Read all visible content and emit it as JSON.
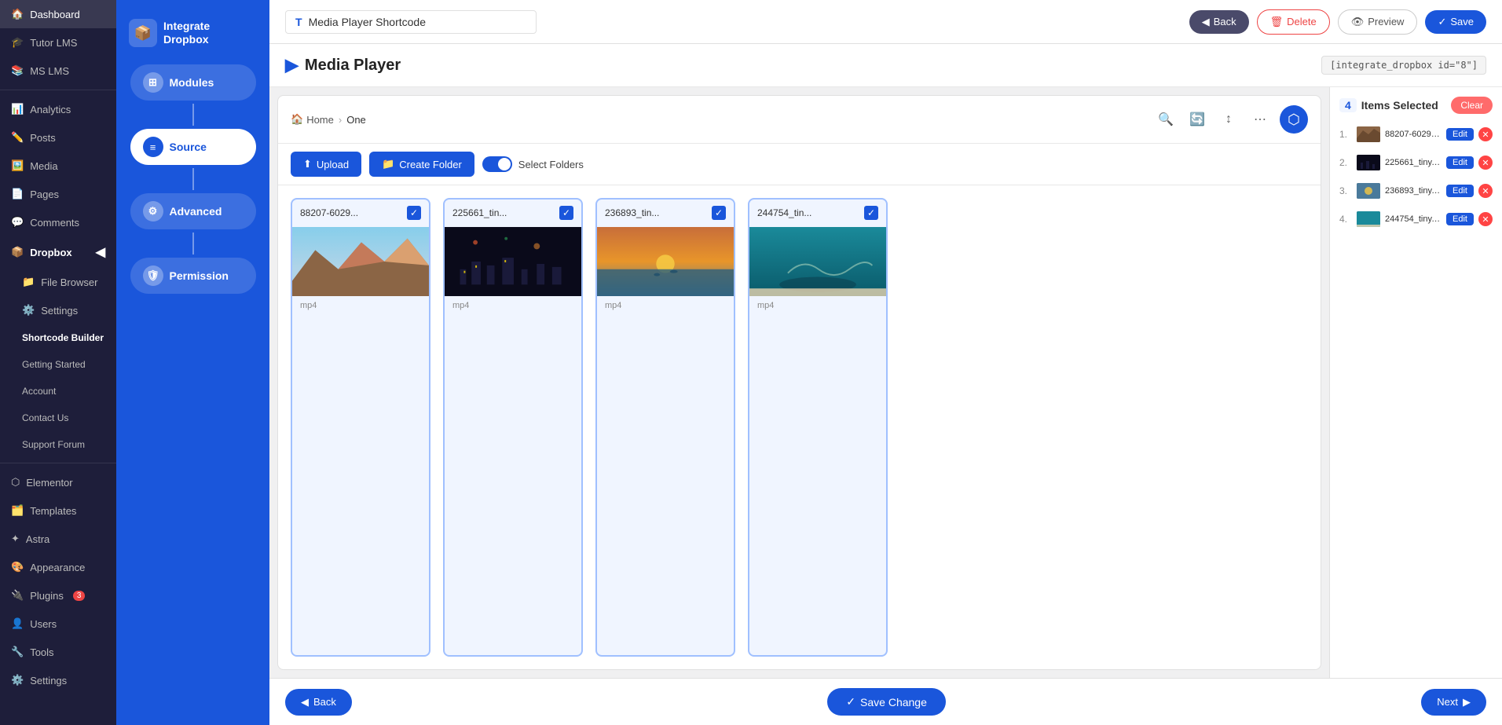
{
  "sidebar": {
    "items": [
      {
        "label": "Dashboard",
        "icon": "🏠"
      },
      {
        "label": "Tutor LMS",
        "icon": "🎓"
      },
      {
        "label": "MS LMS",
        "icon": "📚"
      },
      {
        "label": "Analytics",
        "icon": "📊"
      },
      {
        "label": "Posts",
        "icon": "✏️"
      },
      {
        "label": "Media",
        "icon": "🖼️"
      },
      {
        "label": "Pages",
        "icon": "📄"
      },
      {
        "label": "Comments",
        "icon": "💬"
      },
      {
        "label": "Dropbox",
        "icon": "📦"
      },
      {
        "label": "File Browser",
        "icon": "📁"
      },
      {
        "label": "Settings",
        "icon": "⚙️"
      },
      {
        "label": "Shortcode Builder",
        "icon": ""
      },
      {
        "label": "Getting Started",
        "icon": ""
      },
      {
        "label": "Account",
        "icon": ""
      },
      {
        "label": "Contact Us",
        "icon": ""
      },
      {
        "label": "Support Forum",
        "icon": ""
      },
      {
        "label": "Elementor",
        "icon": "⬡"
      },
      {
        "label": "Templates",
        "icon": "🗂️"
      },
      {
        "label": "Astra",
        "icon": "✦"
      },
      {
        "label": "Appearance",
        "icon": "🎨"
      },
      {
        "label": "Plugins",
        "icon": "🔌",
        "badge": "3"
      },
      {
        "label": "Users",
        "icon": "👤"
      },
      {
        "label": "Tools",
        "icon": "🔧"
      },
      {
        "label": "Settings",
        "icon": "⚙️"
      }
    ]
  },
  "mid_panel": {
    "logo_text1": "Integrate",
    "logo_text2": "Dropbox",
    "steps": [
      {
        "label": "Modules",
        "icon": "⊞",
        "active": false
      },
      {
        "label": "Source",
        "icon": "≡",
        "active": true
      },
      {
        "label": "Advanced",
        "icon": "⚙",
        "active": false
      },
      {
        "label": "Permission",
        "icon": "🛡",
        "active": false
      }
    ],
    "back_label": "Back",
    "save_change_mid_label": "Save Change"
  },
  "top_bar": {
    "title_prefix": "T",
    "title": "Media Player Shortcode",
    "back_label": "Back",
    "delete_label": "Delete",
    "preview_label": "Preview",
    "save_label": "Save"
  },
  "page_header": {
    "title": "Media Player",
    "shortcode": "[integrate_dropbox id=\"8\"]"
  },
  "file_browser": {
    "breadcrumb_home": "Home",
    "breadcrumb_current": "One",
    "upload_label": "Upload",
    "create_folder_label": "Create Folder",
    "select_folders_label": "Select Folders",
    "files": [
      {
        "name": "88207-6029...",
        "type": "mp4",
        "selected": true,
        "thumb": "mountain"
      },
      {
        "name": "225661_tin...",
        "type": "mp4",
        "selected": true,
        "thumb": "night"
      },
      {
        "name": "236893_tin...",
        "type": "mp4",
        "selected": true,
        "thumb": "ocean"
      },
      {
        "name": "244754_tin...",
        "type": "mp4",
        "selected": true,
        "thumb": "underwater"
      }
    ]
  },
  "selected_panel": {
    "count": "4",
    "count_label": "Items Selected",
    "clear_label": "Clear",
    "items": [
      {
        "num": "1.",
        "filename": "88207-602915...",
        "edit_label": "Edit"
      },
      {
        "num": "2.",
        "filename": "225661_tiny.m...",
        "edit_label": "Edit"
      },
      {
        "num": "3.",
        "filename": "236893_tiny.m...",
        "edit_label": "Edit"
      },
      {
        "num": "4.",
        "filename": "244754_tiny.m...",
        "edit_label": "Edit"
      }
    ]
  },
  "bottom_bar": {
    "back_label": "Back",
    "save_change_label": "Save Change",
    "next_label": "Next"
  }
}
